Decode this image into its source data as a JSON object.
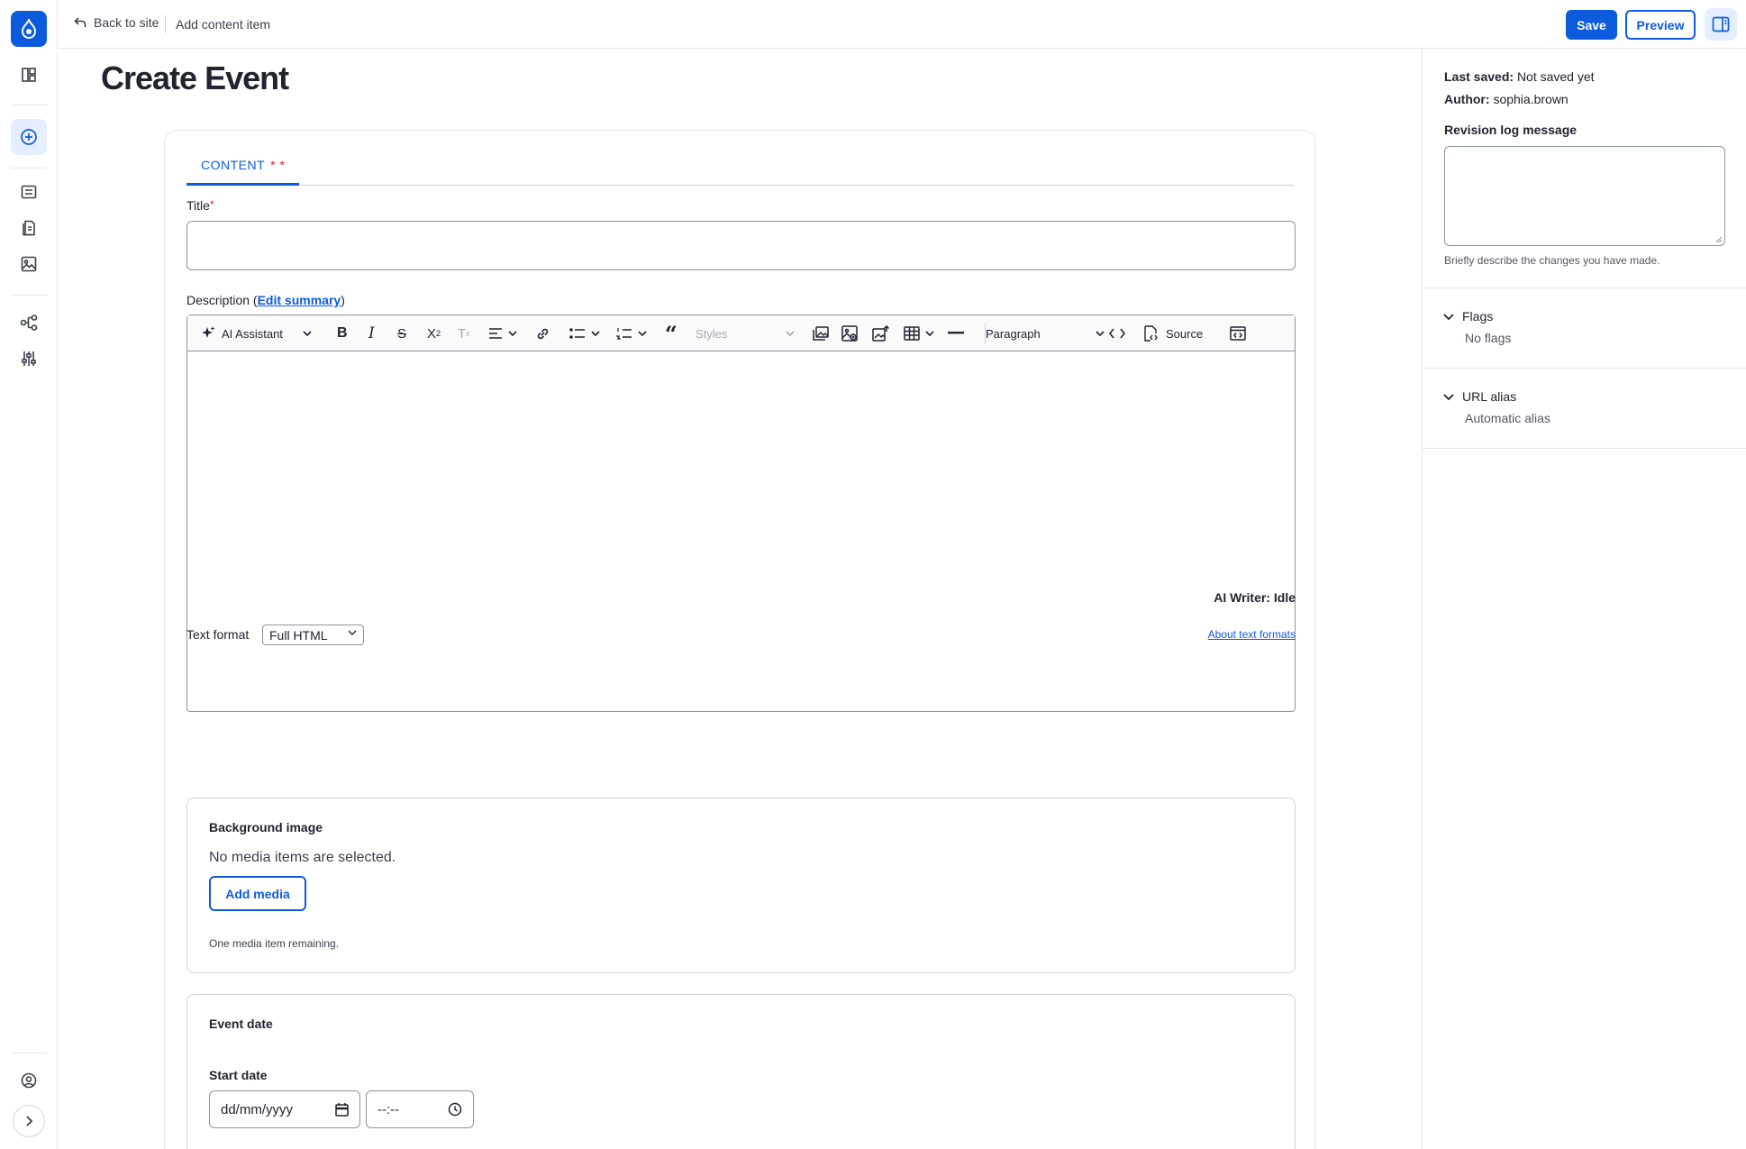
{
  "topbar": {
    "back_label": "Back to site",
    "crumb": "Add content item",
    "save_label": "Save",
    "preview_label": "Preview"
  },
  "rail": {
    "items": [
      "drupal-logo-icon",
      "dashboard-icon",
      "add-content-icon",
      "content-icon",
      "files-icon",
      "media-icon",
      "structure-icon",
      "config-icon",
      "user-icon",
      "expand-icon"
    ],
    "accent": "#0d5bdd"
  },
  "page": {
    "title": "Create Event"
  },
  "tabs": [
    {
      "label": "CONTENT",
      "marks": "* *"
    }
  ],
  "form": {
    "title_label": "Title",
    "required_mark": "*",
    "description_label": "Description (",
    "edit_summary": "Edit summary",
    "description_close": ")",
    "toolbar": {
      "ai_assistant": "AI Assistant",
      "styles": "Styles",
      "paragraph": "Paragraph",
      "source": "Source"
    },
    "ai_writer_status": "AI Writer: Idle",
    "text_format_label": "Text format",
    "text_format_value": "Full HTML",
    "about_text_formats": "About text formats",
    "background_image": {
      "title": "Background image",
      "empty": "No media items are selected.",
      "add_media": "Add media",
      "remaining": "One media item remaining."
    },
    "event_date": {
      "title": "Event date",
      "start_label": "Start date",
      "date_placeholder": "dd/mm/yyyy",
      "time_placeholder": "--:--"
    }
  },
  "meta": {
    "last_saved_label": "Last saved:",
    "last_saved_value": "Not saved yet",
    "author_label": "Author:",
    "author_value": "sophia.brown",
    "revision_label": "Revision log message",
    "revision_help": "Briefly describe the changes you have made.",
    "flags_label": "Flags",
    "flags_summary": "No flags",
    "url_alias_label": "URL alias",
    "url_alias_summary": "Automatic alias"
  }
}
